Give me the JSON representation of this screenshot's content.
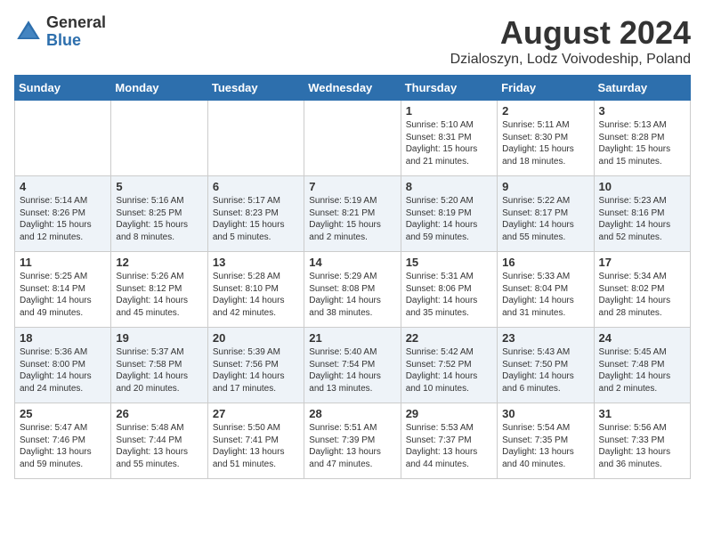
{
  "logo": {
    "general": "General",
    "blue": "Blue"
  },
  "title": "August 2024",
  "location": "Dzialoszyn, Lodz Voivodeship, Poland",
  "days_of_week": [
    "Sunday",
    "Monday",
    "Tuesday",
    "Wednesday",
    "Thursday",
    "Friday",
    "Saturday"
  ],
  "weeks": [
    [
      {
        "day": "",
        "sunrise": "",
        "sunset": "",
        "daylight": ""
      },
      {
        "day": "",
        "sunrise": "",
        "sunset": "",
        "daylight": ""
      },
      {
        "day": "",
        "sunrise": "",
        "sunset": "",
        "daylight": ""
      },
      {
        "day": "",
        "sunrise": "",
        "sunset": "",
        "daylight": ""
      },
      {
        "day": "1",
        "sunrise": "Sunrise: 5:10 AM",
        "sunset": "Sunset: 8:31 PM",
        "daylight": "Daylight: 15 hours and 21 minutes."
      },
      {
        "day": "2",
        "sunrise": "Sunrise: 5:11 AM",
        "sunset": "Sunset: 8:30 PM",
        "daylight": "Daylight: 15 hours and 18 minutes."
      },
      {
        "day": "3",
        "sunrise": "Sunrise: 5:13 AM",
        "sunset": "Sunset: 8:28 PM",
        "daylight": "Daylight: 15 hours and 15 minutes."
      }
    ],
    [
      {
        "day": "4",
        "sunrise": "Sunrise: 5:14 AM",
        "sunset": "Sunset: 8:26 PM",
        "daylight": "Daylight: 15 hours and 12 minutes."
      },
      {
        "day": "5",
        "sunrise": "Sunrise: 5:16 AM",
        "sunset": "Sunset: 8:25 PM",
        "daylight": "Daylight: 15 hours and 8 minutes."
      },
      {
        "day": "6",
        "sunrise": "Sunrise: 5:17 AM",
        "sunset": "Sunset: 8:23 PM",
        "daylight": "Daylight: 15 hours and 5 minutes."
      },
      {
        "day": "7",
        "sunrise": "Sunrise: 5:19 AM",
        "sunset": "Sunset: 8:21 PM",
        "daylight": "Daylight: 15 hours and 2 minutes."
      },
      {
        "day": "8",
        "sunrise": "Sunrise: 5:20 AM",
        "sunset": "Sunset: 8:19 PM",
        "daylight": "Daylight: 14 hours and 59 minutes."
      },
      {
        "day": "9",
        "sunrise": "Sunrise: 5:22 AM",
        "sunset": "Sunset: 8:17 PM",
        "daylight": "Daylight: 14 hours and 55 minutes."
      },
      {
        "day": "10",
        "sunrise": "Sunrise: 5:23 AM",
        "sunset": "Sunset: 8:16 PM",
        "daylight": "Daylight: 14 hours and 52 minutes."
      }
    ],
    [
      {
        "day": "11",
        "sunrise": "Sunrise: 5:25 AM",
        "sunset": "Sunset: 8:14 PM",
        "daylight": "Daylight: 14 hours and 49 minutes."
      },
      {
        "day": "12",
        "sunrise": "Sunrise: 5:26 AM",
        "sunset": "Sunset: 8:12 PM",
        "daylight": "Daylight: 14 hours and 45 minutes."
      },
      {
        "day": "13",
        "sunrise": "Sunrise: 5:28 AM",
        "sunset": "Sunset: 8:10 PM",
        "daylight": "Daylight: 14 hours and 42 minutes."
      },
      {
        "day": "14",
        "sunrise": "Sunrise: 5:29 AM",
        "sunset": "Sunset: 8:08 PM",
        "daylight": "Daylight: 14 hours and 38 minutes."
      },
      {
        "day": "15",
        "sunrise": "Sunrise: 5:31 AM",
        "sunset": "Sunset: 8:06 PM",
        "daylight": "Daylight: 14 hours and 35 minutes."
      },
      {
        "day": "16",
        "sunrise": "Sunrise: 5:33 AM",
        "sunset": "Sunset: 8:04 PM",
        "daylight": "Daylight: 14 hours and 31 minutes."
      },
      {
        "day": "17",
        "sunrise": "Sunrise: 5:34 AM",
        "sunset": "Sunset: 8:02 PM",
        "daylight": "Daylight: 14 hours and 28 minutes."
      }
    ],
    [
      {
        "day": "18",
        "sunrise": "Sunrise: 5:36 AM",
        "sunset": "Sunset: 8:00 PM",
        "daylight": "Daylight: 14 hours and 24 minutes."
      },
      {
        "day": "19",
        "sunrise": "Sunrise: 5:37 AM",
        "sunset": "Sunset: 7:58 PM",
        "daylight": "Daylight: 14 hours and 20 minutes."
      },
      {
        "day": "20",
        "sunrise": "Sunrise: 5:39 AM",
        "sunset": "Sunset: 7:56 PM",
        "daylight": "Daylight: 14 hours and 17 minutes."
      },
      {
        "day": "21",
        "sunrise": "Sunrise: 5:40 AM",
        "sunset": "Sunset: 7:54 PM",
        "daylight": "Daylight: 14 hours and 13 minutes."
      },
      {
        "day": "22",
        "sunrise": "Sunrise: 5:42 AM",
        "sunset": "Sunset: 7:52 PM",
        "daylight": "Daylight: 14 hours and 10 minutes."
      },
      {
        "day": "23",
        "sunrise": "Sunrise: 5:43 AM",
        "sunset": "Sunset: 7:50 PM",
        "daylight": "Daylight: 14 hours and 6 minutes."
      },
      {
        "day": "24",
        "sunrise": "Sunrise: 5:45 AM",
        "sunset": "Sunset: 7:48 PM",
        "daylight": "Daylight: 14 hours and 2 minutes."
      }
    ],
    [
      {
        "day": "25",
        "sunrise": "Sunrise: 5:47 AM",
        "sunset": "Sunset: 7:46 PM",
        "daylight": "Daylight: 13 hours and 59 minutes."
      },
      {
        "day": "26",
        "sunrise": "Sunrise: 5:48 AM",
        "sunset": "Sunset: 7:44 PM",
        "daylight": "Daylight: 13 hours and 55 minutes."
      },
      {
        "day": "27",
        "sunrise": "Sunrise: 5:50 AM",
        "sunset": "Sunset: 7:41 PM",
        "daylight": "Daylight: 13 hours and 51 minutes."
      },
      {
        "day": "28",
        "sunrise": "Sunrise: 5:51 AM",
        "sunset": "Sunset: 7:39 PM",
        "daylight": "Daylight: 13 hours and 47 minutes."
      },
      {
        "day": "29",
        "sunrise": "Sunrise: 5:53 AM",
        "sunset": "Sunset: 7:37 PM",
        "daylight": "Daylight: 13 hours and 44 minutes."
      },
      {
        "day": "30",
        "sunrise": "Sunrise: 5:54 AM",
        "sunset": "Sunset: 7:35 PM",
        "daylight": "Daylight: 13 hours and 40 minutes."
      },
      {
        "day": "31",
        "sunrise": "Sunrise: 5:56 AM",
        "sunset": "Sunset: 7:33 PM",
        "daylight": "Daylight: 13 hours and 36 minutes."
      }
    ]
  ]
}
